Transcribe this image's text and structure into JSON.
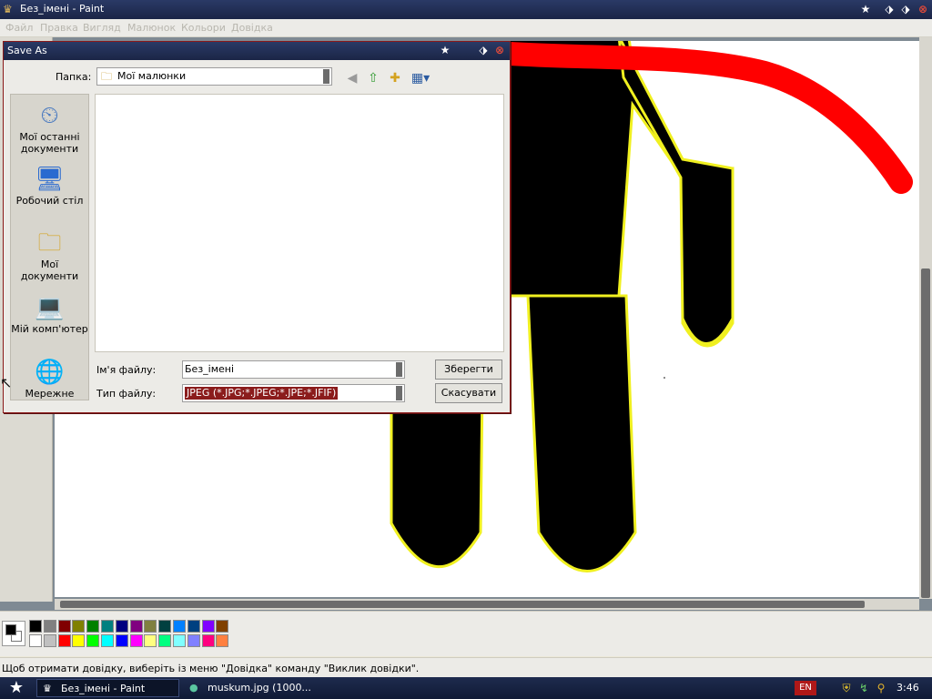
{
  "window": {
    "title": "Без_імені - Paint",
    "controls": {
      "pin": "★",
      "restore": "⬗",
      "maximize": "⬗",
      "close": "⊗"
    }
  },
  "menubar": {
    "items": [
      "Файл",
      "Правка",
      "Вигляд",
      "Малюнок",
      "Кольори",
      "Довідка"
    ]
  },
  "palette": {
    "colors_row1": [
      "#000000",
      "#808080",
      "#800000",
      "#808000",
      "#008000",
      "#008080",
      "#000080",
      "#800080",
      "#808040",
      "#004040",
      "#0080ff",
      "#004080",
      "#8000ff",
      "#804000"
    ],
    "colors_row2": [
      "#ffffff",
      "#c0c0c0",
      "#ff0000",
      "#ffff00",
      "#00ff00",
      "#00ffff",
      "#0000ff",
      "#ff00ff",
      "#ffff80",
      "#00ff80",
      "#80ffff",
      "#8080ff",
      "#ff0080",
      "#ff8040"
    ],
    "foreground": "#000000",
    "background": "#ffffff"
  },
  "statusbar": {
    "text": "Щоб отримати довідку, виберіть із меню \"Довідка\" команду \"Виклик довідки\"."
  },
  "dialog": {
    "title": "Save As",
    "location_label": "Папка:",
    "location_value": "Мої малюнки",
    "places": [
      {
        "label_1": "Мої останні",
        "label_2": "документи",
        "icon": "recent-docs-icon"
      },
      {
        "label_1": "Робочий стіл",
        "label_2": "",
        "icon": "desktop-icon"
      },
      {
        "label_1": "Мої документи",
        "label_2": "",
        "icon": "my-documents-icon"
      },
      {
        "label_1": "Мій комп'ютер",
        "label_2": "",
        "icon": "my-computer-icon"
      },
      {
        "label_1": "Мережне",
        "label_2": "",
        "icon": "network-icon"
      }
    ],
    "filename_label": "Ім'я файлу:",
    "filename_value": "Без_імені",
    "filetype_label": "Тип файлу:",
    "filetype_value": "JPEG (*.JPG;*.JPEG;*.JPE;*.JFIF)",
    "save_button": "Зберегти",
    "cancel_button": "Скасувати"
  },
  "taskbar": {
    "start_icon": "★",
    "tasks": [
      {
        "label": "Без_імені - Paint",
        "active": true
      },
      {
        "label": "muskum.jpg (1000...",
        "active": false
      }
    ],
    "language": "EN",
    "clock": "3:46"
  },
  "colors": {
    "accent": "#8b1c1c",
    "titlebar": "#1b2546",
    "drawing_red": "#ff0000",
    "drawing_outline": "#f0f020"
  }
}
